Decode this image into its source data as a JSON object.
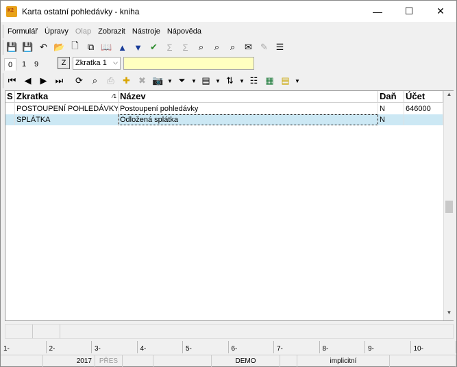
{
  "window": {
    "title": "Karta ostatní pohledávky - kniha"
  },
  "menu": [
    "Formulář",
    "Úpravy",
    "Olap",
    "Zobrazit",
    "Nástroje",
    "Nápověda"
  ],
  "tabs": [
    "0",
    "1",
    "9"
  ],
  "z_button": "Z",
  "sort_select": {
    "value": "Zkratka 1"
  },
  "grid": {
    "columns": [
      "S",
      "Zkratka",
      "Název",
      "Daň",
      "Účet"
    ],
    "rows": [
      {
        "zkratka": "POSTOUPENÍ POHLEDÁVKY",
        "nazev": "Postoupení pohledávky",
        "dan": "N",
        "ucet": "646000"
      },
      {
        "zkratka": "SPLÁTKA",
        "nazev": "Odložená splátka",
        "dan": "N",
        "ucet": ""
      }
    ]
  },
  "ruler": [
    "1-",
    "2-",
    "3-",
    "4-",
    "5-",
    "6-",
    "7-",
    "8-",
    "9-",
    "10-"
  ],
  "status": {
    "year": "2017",
    "mode": "PŘES",
    "db": "DEMO",
    "profile": "implicitní"
  }
}
